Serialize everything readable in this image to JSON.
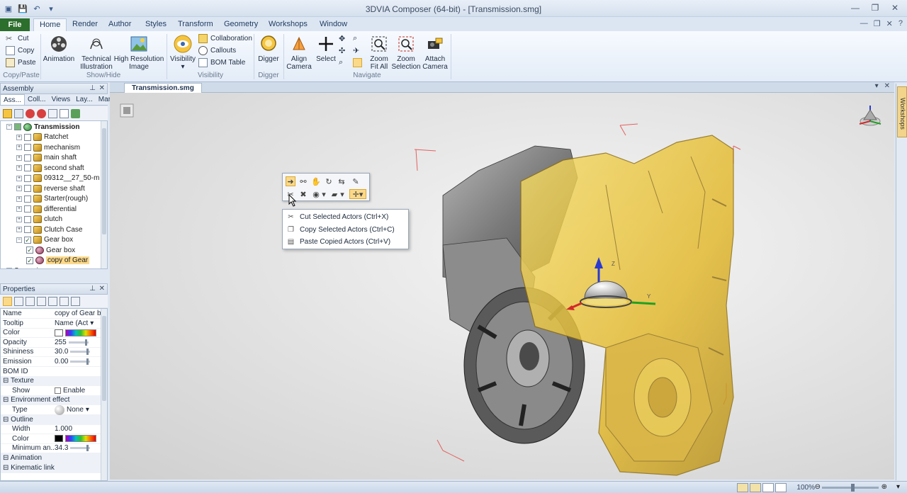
{
  "window": {
    "title": "3DVIA Composer (64-bit) - [Transmission.smg]"
  },
  "ribbon": {
    "tabs": [
      "File",
      "Home",
      "Render",
      "Author",
      "Styles",
      "Transform",
      "Geometry",
      "Workshops",
      "Window"
    ],
    "active_tab": "Home",
    "clipboard": {
      "cut": "Cut",
      "copy": "Copy",
      "paste": "Paste",
      "group": "Copy/Paste"
    },
    "showhide": {
      "animation": "Animation",
      "technical_1": "Technical",
      "technical_2": "Illustration",
      "highres_1": "High Resolution",
      "highres_2": "Image",
      "group": "Show/Hide"
    },
    "visibility": {
      "visibility": "Visibility",
      "collaboration": "Collaboration",
      "callouts": "Callouts",
      "bom_table": "BOM Table",
      "group": "Visibility"
    },
    "digger": {
      "digger": "Digger",
      "group": "Digger"
    },
    "navigate": {
      "align_1": "Align",
      "align_2": "Camera",
      "select": "Select",
      "zoomfit_1": "Zoom",
      "zoomfit_2": "Fit All",
      "zoomsel_1": "Zoom",
      "zoomsel_2": "Selection",
      "attach_1": "Attach",
      "attach_2": "Camera",
      "group": "Navigate"
    }
  },
  "assembly_panel": {
    "title": "Assembly",
    "subtabs": [
      "Ass...",
      "Coll...",
      "Views",
      "Lay...",
      "Mar..."
    ],
    "tree": [
      {
        "label": "Transmission",
        "level": 0,
        "bold": true,
        "checked": "partial",
        "icon": "globe"
      },
      {
        "label": "Ratchet",
        "level": 1,
        "checked": "off",
        "icon": "group"
      },
      {
        "label": "mechanism",
        "level": 1,
        "checked": "off",
        "icon": "group"
      },
      {
        "label": "main shaft",
        "level": 1,
        "checked": "off",
        "icon": "group"
      },
      {
        "label": "second shaft",
        "level": 1,
        "checked": "off",
        "icon": "group"
      },
      {
        "label": "09312__27_50-m",
        "level": 1,
        "checked": "off",
        "icon": "group"
      },
      {
        "label": "reverse shaft",
        "level": 1,
        "checked": "off",
        "icon": "group"
      },
      {
        "label": "Starter(rough)",
        "level": 1,
        "checked": "off",
        "icon": "group"
      },
      {
        "label": "differential",
        "level": 1,
        "checked": "off",
        "icon": "group"
      },
      {
        "label": "clutch",
        "level": 1,
        "checked": "off",
        "icon": "group"
      },
      {
        "label": "Clutch Case",
        "level": 1,
        "checked": "off",
        "icon": "group"
      },
      {
        "label": "Gear box",
        "level": 1,
        "checked": "on",
        "icon": "group"
      },
      {
        "label": "Gear box",
        "level": 2,
        "checked": "on",
        "icon": "part"
      },
      {
        "label": "copy of Gear",
        "level": 2,
        "checked": "on",
        "icon": "part",
        "selected": true
      },
      {
        "label": "Scenarios",
        "level": 0,
        "checked": "none",
        "icon": "none"
      }
    ]
  },
  "properties_panel": {
    "title": "Properties",
    "rows": [
      {
        "key": "Name",
        "value": "copy of Gear bc",
        "type": "text"
      },
      {
        "key": "Tooltip",
        "value": "Name (Act",
        "type": "dropdown"
      },
      {
        "key": "Color",
        "value": "",
        "type": "color"
      },
      {
        "key": "Opacity",
        "value": "255",
        "type": "slider"
      },
      {
        "key": "Shininess",
        "value": "30.0",
        "type": "slider"
      },
      {
        "key": "Emission",
        "value": "0.00",
        "type": "slider"
      },
      {
        "key": "BOM ID",
        "value": "",
        "type": "text"
      },
      {
        "key": "Texture",
        "value": "",
        "type": "category"
      },
      {
        "key": "Show",
        "value": "Enable",
        "type": "checkbox",
        "indent": true
      },
      {
        "key": "Environment effect",
        "value": "",
        "type": "category"
      },
      {
        "key": "Type",
        "value": "None",
        "type": "sphere-dropdown",
        "indent": true
      },
      {
        "key": "Outline",
        "value": "",
        "type": "category"
      },
      {
        "key": "Width",
        "value": "1.000",
        "type": "text",
        "indent": true
      },
      {
        "key": "Color",
        "value": "",
        "type": "color-dark",
        "indent": true
      },
      {
        "key": "Minimum an...",
        "value": "34.3",
        "type": "slider",
        "indent": true
      },
      {
        "key": "Animation",
        "value": "",
        "type": "category"
      },
      {
        "key": "Kinematic link",
        "value": "",
        "type": "category"
      }
    ]
  },
  "document": {
    "tab": "Transmission.smg"
  },
  "context_menu": {
    "items": [
      {
        "label": "Cut Selected Actors (Ctrl+X)",
        "icon": "scissors-icon"
      },
      {
        "label": "Copy Selected Actors (Ctrl+C)",
        "icon": "copy-icon"
      },
      {
        "label": "Paste Copied Actors (Ctrl+V)",
        "icon": "paste-icon"
      }
    ]
  },
  "workshops_sidebar": {
    "label": "Workshops"
  },
  "statusbar": {
    "zoom": "100%"
  },
  "colors": {
    "accent_file": "#2c6e2c",
    "selection": "#fbd98a",
    "gear_yellow": "#e8c33a",
    "gear_gray": "#8a8a8a"
  }
}
